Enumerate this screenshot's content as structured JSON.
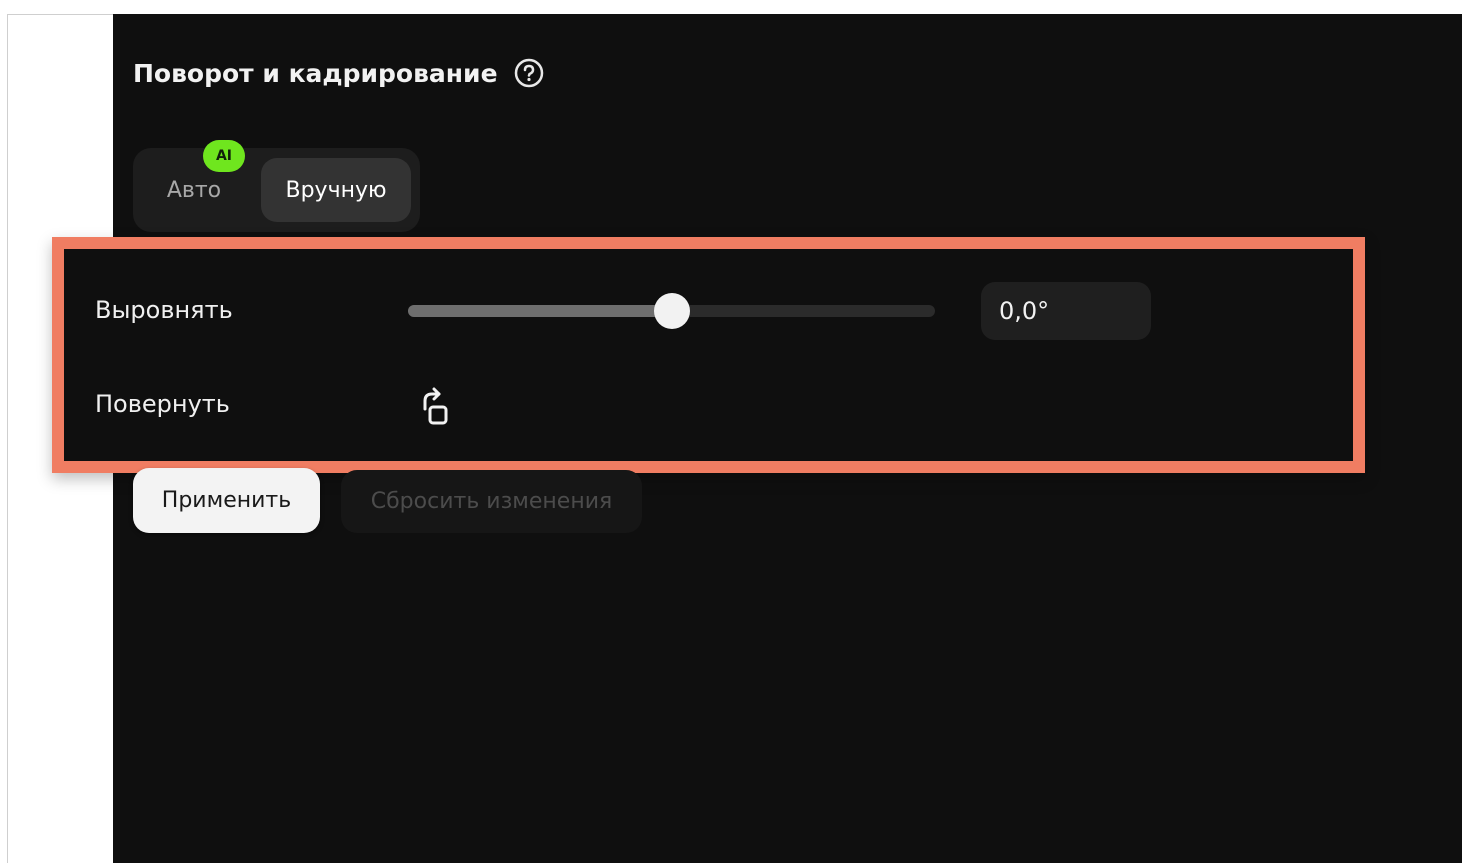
{
  "panel": {
    "title": "Поворот и кадрирование",
    "help_icon": "help-circle-icon"
  },
  "mode_toggle": {
    "auto_label": "Авто",
    "ai_badge": "AI",
    "manual_label": "Вручную",
    "selected": "Вручную"
  },
  "straighten": {
    "label": "Выровнять",
    "slider_fraction": 0.5,
    "value": "0,0°"
  },
  "rotate": {
    "label": "Повернуть",
    "icon": "rotate-icon"
  },
  "actions": {
    "apply_label": "Применить",
    "reset_label": "Сбросить изменения"
  },
  "colors": {
    "panel_bg": "#0f0f0f",
    "highlight_border": "#f07d62",
    "ai_badge_bg": "#6fe61e",
    "apply_bg": "#f3f3f3"
  }
}
